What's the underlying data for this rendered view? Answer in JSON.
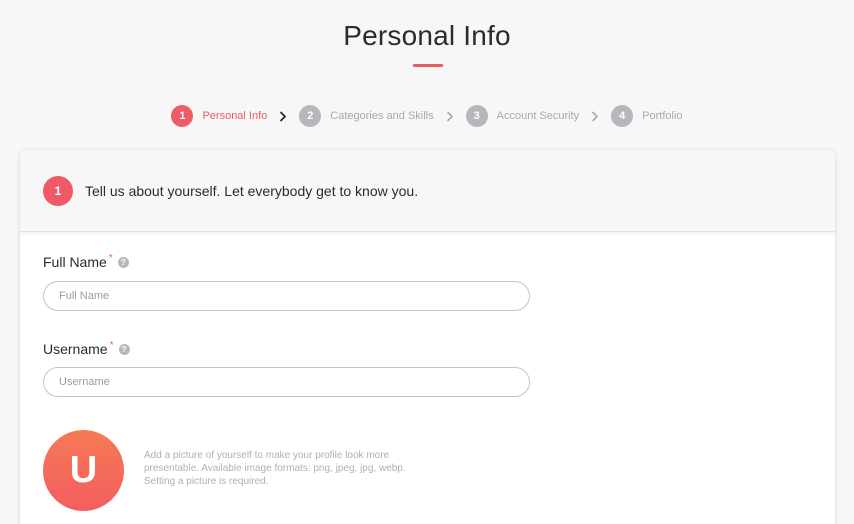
{
  "page": {
    "title": "Personal Info"
  },
  "steps": [
    {
      "number": "1",
      "label": "Personal Info",
      "active": true
    },
    {
      "number": "2",
      "label": "Categories and Skills",
      "active": false
    },
    {
      "number": "3",
      "label": "Account Security",
      "active": false
    },
    {
      "number": "4",
      "label": "Portfolio",
      "active": false
    }
  ],
  "colors": {
    "accent": "#f05a66",
    "inactive_step": "#b6b6bd",
    "underline": "#e85d5d"
  },
  "card": {
    "header_number": "1",
    "header_text": "Tell us about yourself. Let everybody get to know you."
  },
  "form": {
    "full_name": {
      "label": "Full Name",
      "required_mark": "*",
      "placeholder": "Full Name",
      "value": ""
    },
    "username": {
      "label": "Username",
      "required_mark": "*",
      "placeholder": "Username",
      "value": ""
    },
    "avatar": {
      "initial": "U",
      "hint": "Add a picture of yourself to make your profile look more presentable. Available image formats: png, jpeg, jpg, webp. Setting a picture is required."
    }
  },
  "icons": {
    "help": "help-circle-icon",
    "step_separator": "chevron-right-icon"
  }
}
